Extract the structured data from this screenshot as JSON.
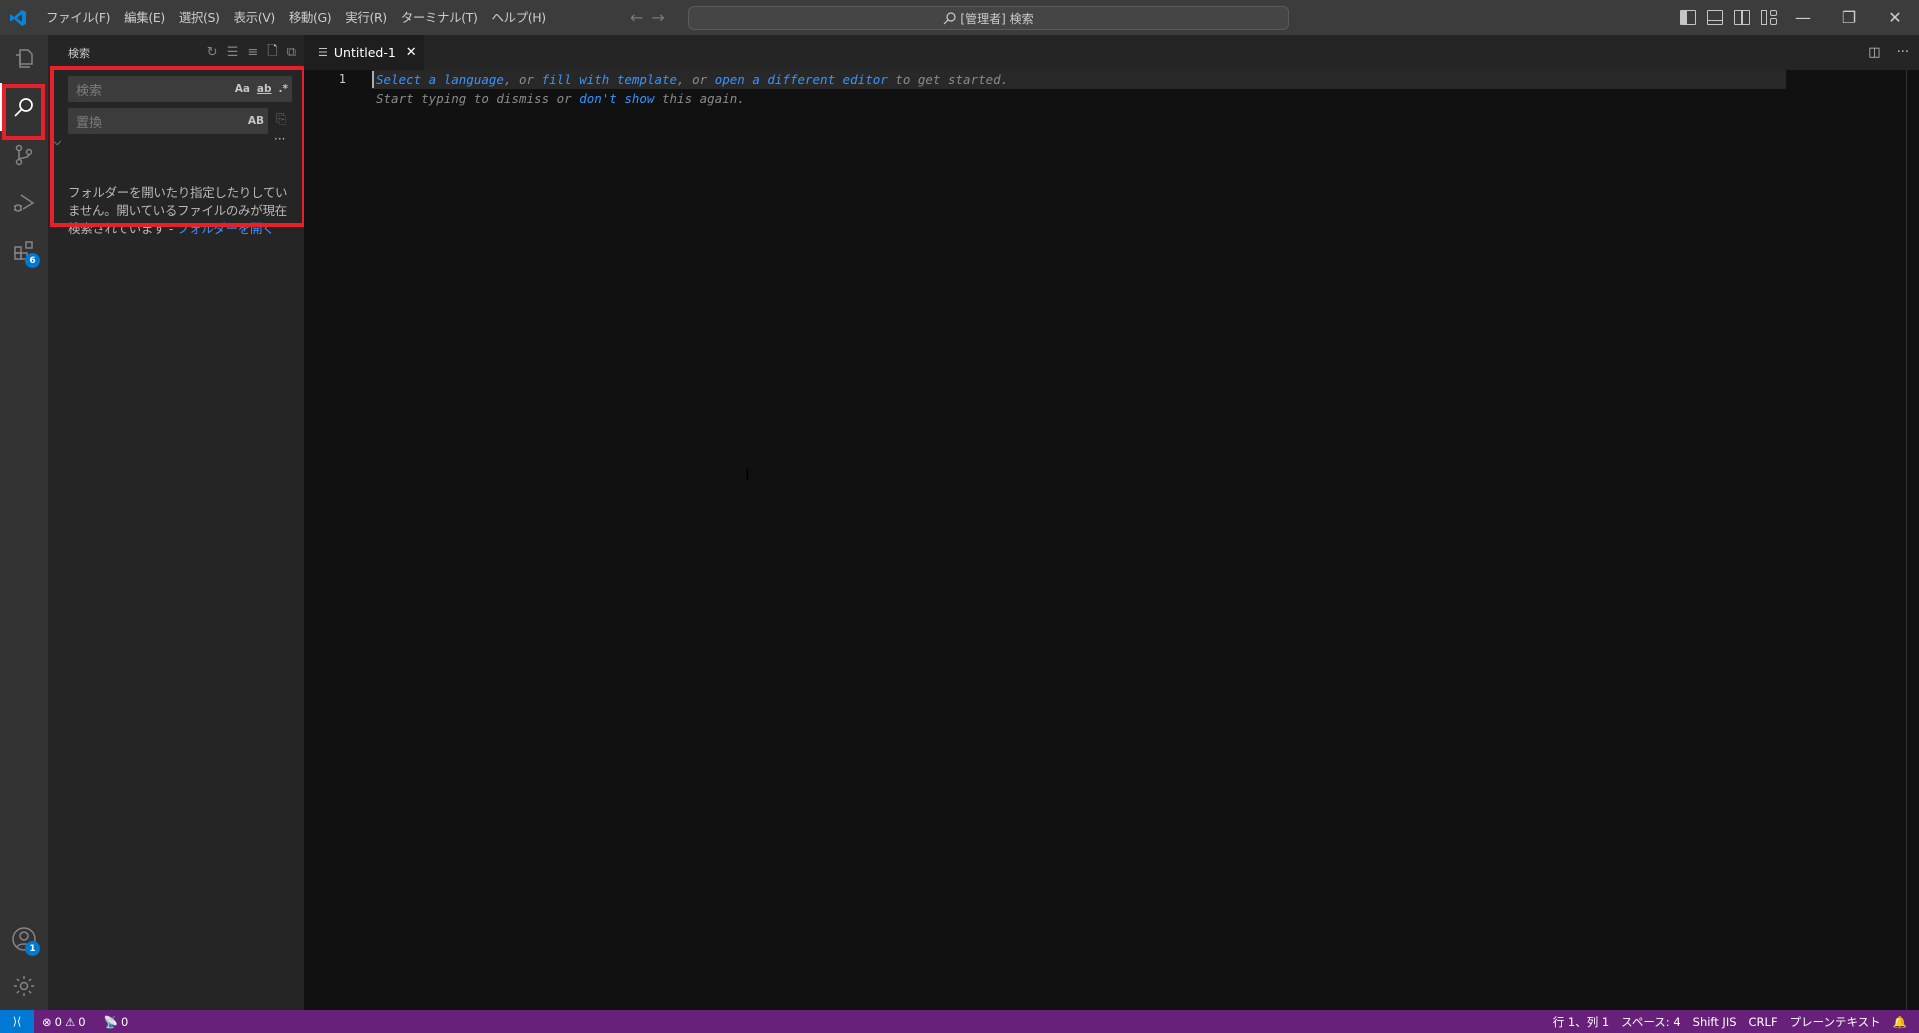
{
  "titlebar": {
    "menu": [
      "ファイル(F)",
      "編集(E)",
      "選択(S)",
      "表示(V)",
      "移動(G)",
      "実行(R)",
      "ターミナル(T)",
      "ヘルプ(H)"
    ],
    "command_center": "[管理者] 検索",
    "back_icon": "←",
    "forward_icon": "→",
    "minimize": "—",
    "restore": "❐",
    "close": "✕"
  },
  "activitybar": {
    "items": [
      {
        "name": "explorer",
        "icon": "files-icon"
      },
      {
        "name": "search",
        "icon": "search-icon",
        "active": true
      },
      {
        "name": "source-control",
        "icon": "source-control-icon"
      },
      {
        "name": "run-debug",
        "icon": "run-debug-icon"
      },
      {
        "name": "extensions",
        "icon": "extensions-icon",
        "badge": "6"
      }
    ],
    "accounts_badge": "1"
  },
  "sidebar": {
    "title": "検索",
    "search_placeholder": "検索",
    "replace_placeholder": "置換",
    "match_case": "Aa",
    "whole_word": "ab",
    "regex": ".*",
    "preserve_case": "AB",
    "more": "···",
    "message": "フォルダーを開いたり指定したりしていません。開いているファイルのみが現在検索されています - ",
    "open_folder_link": "フォルダーを開く"
  },
  "editor": {
    "tab_label": "Untitled-1",
    "line_number": "1",
    "hint_line1": [
      {
        "text": "Select a language",
        "link": true
      },
      {
        "text": ", or ",
        "link": false
      },
      {
        "text": "fill with template",
        "link": true
      },
      {
        "text": ", or ",
        "link": false
      },
      {
        "text": "open a different editor",
        "link": true
      },
      {
        "text": " to get started.",
        "link": false
      }
    ],
    "hint_line2": [
      {
        "text": "Start typing to dismiss or ",
        "link": false
      },
      {
        "text": "don't show",
        "link": true
      },
      {
        "text": " this again.",
        "link": false
      }
    ]
  },
  "statusbar": {
    "errors": "0",
    "warnings": "0",
    "ports": "0",
    "position": "行 1、列 1",
    "spaces": "スペース: 4",
    "encoding": "Shift JIS",
    "eol": "CRLF",
    "language": "プレーンテキスト"
  },
  "colors": {
    "statusbar": "#68217a",
    "remote": "#0078d4",
    "highlight": "#e8202a",
    "link": "#3794ff"
  }
}
